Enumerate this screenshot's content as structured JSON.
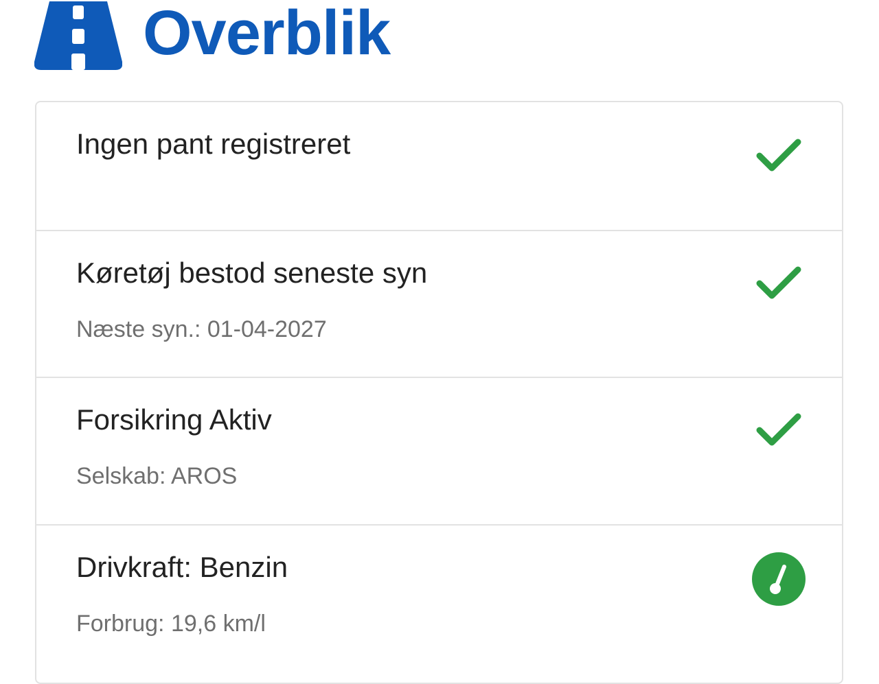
{
  "header": {
    "title": "Overblik",
    "icon": "road-icon",
    "title_color": "#0f5ab8"
  },
  "overview": {
    "items": [
      {
        "title": "Ingen pant registreret",
        "subtitle": "",
        "status_icon": "check-icon",
        "status_color": "#2e9e44"
      },
      {
        "title": "Køretøj bestod seneste syn",
        "subtitle": "Næste syn.: 01-04-2027",
        "status_icon": "check-icon",
        "status_color": "#2e9e44"
      },
      {
        "title": "Forsikring Aktiv",
        "subtitle": "Selskab: AROS",
        "status_icon": "check-icon",
        "status_color": "#2e9e44"
      },
      {
        "title": "Drivkraft: Benzin",
        "subtitle": "Forbrug: 19,6 km/l",
        "status_icon": "gauge-icon",
        "status_color": "#2e9e44"
      }
    ]
  }
}
